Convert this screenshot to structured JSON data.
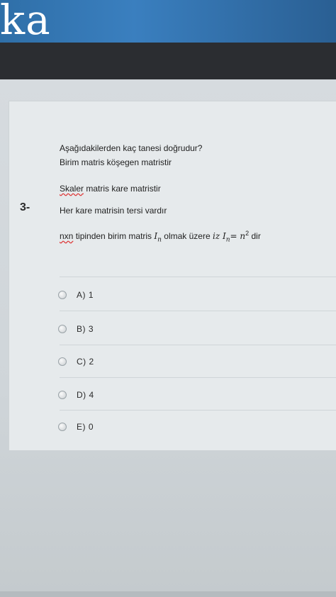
{
  "header": {
    "brand_text": "ka"
  },
  "question": {
    "number": "3-",
    "prompt": "Aşağıdakilerden kaç tanesi doğrudur?",
    "statements": {
      "s1": "Birim matris köşegen matristir",
      "s2_word": "Skaler",
      "s2_rest": " matris kare matristir",
      "s3": "Her kare matrisin tersi vardır",
      "s4_word": "nxn",
      "s4_mid": " tipinden birim matris ",
      "s4_I": "I",
      "s4_n": "n",
      "s4_olmak": " olmak üzere ",
      "s4_iz": "iz ",
      "s4_eq": "= n",
      "s4_sup": "2",
      "s4_end": " dir"
    },
    "options": [
      {
        "label": "A)  1"
      },
      {
        "label": "B)  3"
      },
      {
        "label": "C)  2"
      },
      {
        "label": "D)  4"
      },
      {
        "label": "E)  0"
      }
    ]
  }
}
